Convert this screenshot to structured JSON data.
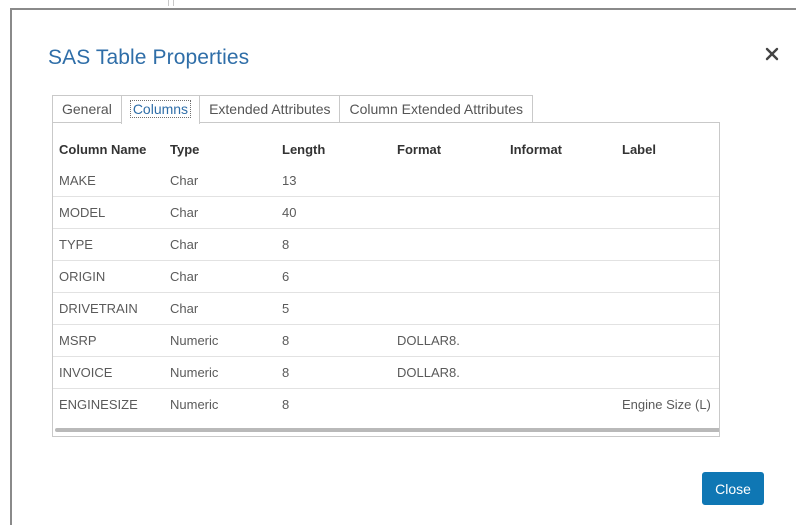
{
  "dialog": {
    "title": "SAS Table Properties",
    "close_icon": "close-icon",
    "close_button_label": "Close"
  },
  "tabs": [
    {
      "label": "General",
      "active": false
    },
    {
      "label": "Columns",
      "active": true
    },
    {
      "label": "Extended Attributes",
      "active": false
    },
    {
      "label": "Column Extended Attributes",
      "active": false
    }
  ],
  "table": {
    "headers": [
      "Column Name",
      "Type",
      "Length",
      "Format",
      "Informat",
      "Label"
    ],
    "rows": [
      {
        "name": "MAKE",
        "type": "Char",
        "length": "13",
        "format": "",
        "informat": "",
        "label": ""
      },
      {
        "name": "MODEL",
        "type": "Char",
        "length": "40",
        "format": "",
        "informat": "",
        "label": ""
      },
      {
        "name": "TYPE",
        "type": "Char",
        "length": "8",
        "format": "",
        "informat": "",
        "label": ""
      },
      {
        "name": "ORIGIN",
        "type": "Char",
        "length": "6",
        "format": "",
        "informat": "",
        "label": ""
      },
      {
        "name": "DRIVETRAIN",
        "type": "Char",
        "length": "5",
        "format": "",
        "informat": "",
        "label": ""
      },
      {
        "name": "MSRP",
        "type": "Numeric",
        "length": "8",
        "format": "DOLLAR8.",
        "informat": "",
        "label": ""
      },
      {
        "name": "INVOICE",
        "type": "Numeric",
        "length": "8",
        "format": "DOLLAR8.",
        "informat": "",
        "label": ""
      },
      {
        "name": "ENGINESIZE",
        "type": "Numeric",
        "length": "8",
        "format": "",
        "informat": "",
        "label": "Engine Size (L)"
      }
    ]
  },
  "colors": {
    "title": "#2f6ea8",
    "active_tab": "#2f6ea8",
    "close_button_bg": "#0f77b4",
    "close_button_text": "#ffffff"
  }
}
